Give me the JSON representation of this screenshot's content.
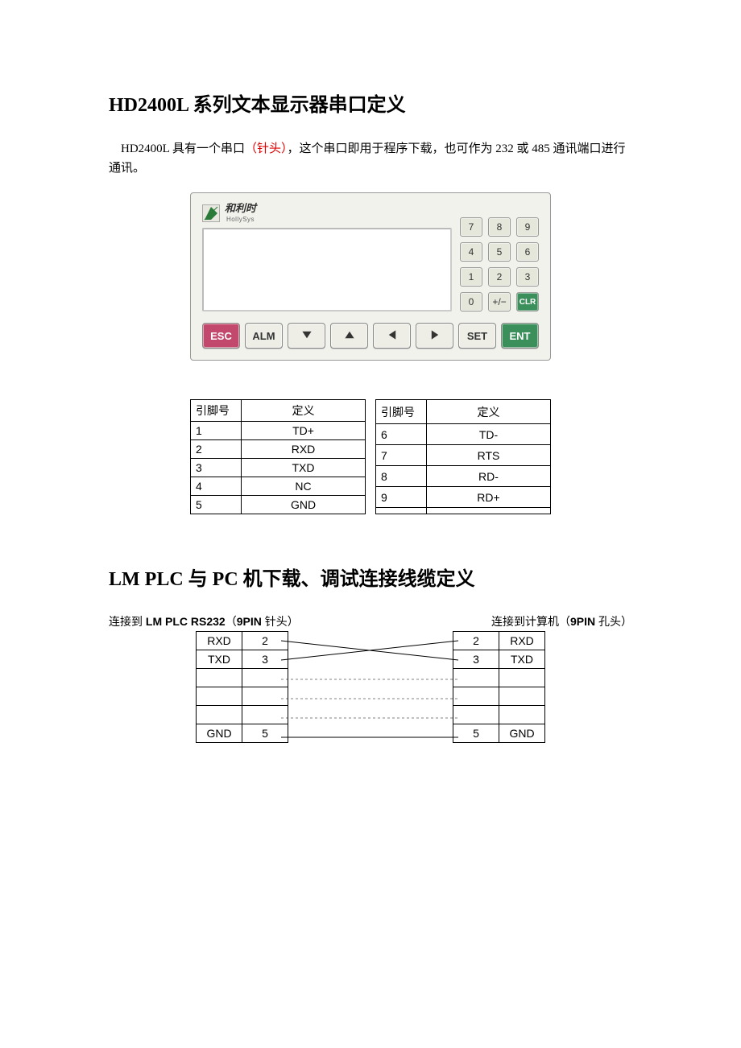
{
  "section1": {
    "title": "HD2400L 系列文本显示器串口定义",
    "intro_pre": "HD2400L 具有一个串口",
    "intro_red": "（针头）",
    "intro_post": "，这个串口即用于程序下载，也可作为 232 或 485 通讯端口进行通讯。"
  },
  "device": {
    "logo_cn": "和利时",
    "logo_en": "HollySys",
    "keypad": [
      "7",
      "8",
      "9",
      "4",
      "5",
      "6",
      "1",
      "2",
      "3",
      "0",
      "+/−",
      "CLR"
    ],
    "buttons": {
      "esc": "ESC",
      "alm": "ALM",
      "set": "SET",
      "ent": "ENT"
    }
  },
  "pin_table": {
    "header_pin": "引脚号",
    "header_def": "定义",
    "rows": [
      {
        "pin": "1",
        "def": "TD+"
      },
      {
        "pin": "2",
        "def": "RXD"
      },
      {
        "pin": "3",
        "def": "TXD"
      },
      {
        "pin": "4",
        "def": "NC"
      },
      {
        "pin": "5",
        "def": "GND"
      },
      {
        "pin": "6",
        "def": "TD-"
      },
      {
        "pin": "7",
        "def": "RTS"
      },
      {
        "pin": "8",
        "def": "RD-"
      },
      {
        "pin": "9",
        "def": "RD+"
      },
      {
        "pin": "",
        "def": ""
      }
    ]
  },
  "section2": {
    "title": "LM PLC 与 PC 机下载、调试连接线缆定义",
    "left_label_pre": "连接到 ",
    "left_label_bold": "LM PLC RS232",
    "left_label_post": "（",
    "left_label_bold2": "9PIN",
    "left_label_post2": " 针头）",
    "right_label_pre": "连接到计算机（",
    "right_label_bold": "9PIN",
    "right_label_post": " 孔头）"
  },
  "cable": {
    "left": [
      {
        "name": "RXD",
        "pin": "2"
      },
      {
        "name": "TXD",
        "pin": "3"
      },
      {
        "name": "",
        "pin": ""
      },
      {
        "name": "",
        "pin": ""
      },
      {
        "name": "",
        "pin": ""
      },
      {
        "name": "GND",
        "pin": "5"
      }
    ],
    "right": [
      {
        "pin": "2",
        "name": "RXD"
      },
      {
        "pin": "3",
        "name": "TXD"
      },
      {
        "pin": "",
        "name": ""
      },
      {
        "pin": "",
        "name": ""
      },
      {
        "pin": "",
        "name": ""
      },
      {
        "pin": "5",
        "name": "GND"
      }
    ]
  }
}
